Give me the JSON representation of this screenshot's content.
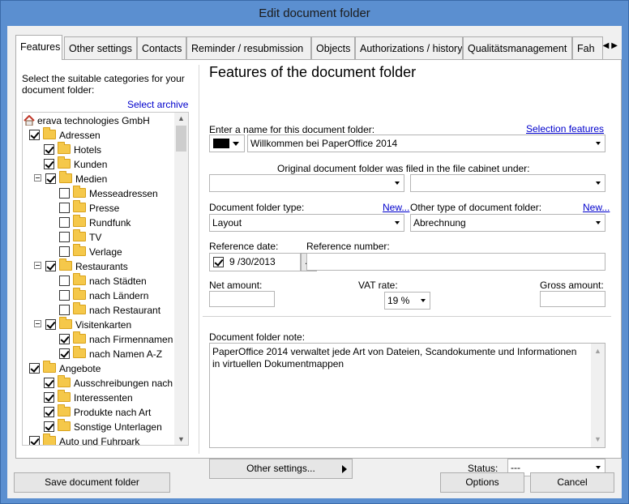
{
  "window": {
    "title": "Edit document folder"
  },
  "tabs": [
    {
      "label": "Features",
      "active": true
    },
    {
      "label": "Other settings"
    },
    {
      "label": "Contacts"
    },
    {
      "label": "Reminder / resubmission"
    },
    {
      "label": "Objects"
    },
    {
      "label": "Authorizations / history"
    },
    {
      "label": "Qualitätsmanagement"
    },
    {
      "label": "Fah"
    }
  ],
  "tab_scroll": {
    "left": "◀",
    "right": "▶"
  },
  "left": {
    "instruction": "Select the suitable categories for your document folder:",
    "select_archive": "Select archive",
    "tree": [
      {
        "label": "erava technologies GmbH",
        "level": 0,
        "type": "root"
      },
      {
        "label": "Adressen",
        "level": 0,
        "checked": true
      },
      {
        "label": "Hotels",
        "level": 1,
        "checked": true
      },
      {
        "label": "Kunden",
        "level": 1,
        "checked": true
      },
      {
        "label": "Medien",
        "level": 1,
        "checked": true,
        "expander": true
      },
      {
        "label": "Messeadressen",
        "level": 2,
        "checked": false
      },
      {
        "label": "Presse",
        "level": 2,
        "checked": false
      },
      {
        "label": "Rundfunk",
        "level": 2,
        "checked": false
      },
      {
        "label": "TV",
        "level": 2,
        "checked": false
      },
      {
        "label": "Verlage",
        "level": 2,
        "checked": false
      },
      {
        "label": "Restaurants",
        "level": 1,
        "checked": true,
        "expander": true
      },
      {
        "label": "nach Städten",
        "level": 2,
        "checked": false
      },
      {
        "label": "nach Ländern",
        "level": 2,
        "checked": false
      },
      {
        "label": "nach Restaurant",
        "level": 2,
        "checked": false
      },
      {
        "label": "Visitenkarten",
        "level": 1,
        "checked": true,
        "expander": true
      },
      {
        "label": "nach Firmennamen A-Z",
        "level": 2,
        "checked": true
      },
      {
        "label": "nach Namen A-Z",
        "level": 2,
        "checked": true
      },
      {
        "label": "Angebote",
        "level": 0,
        "checked": true
      },
      {
        "label": "Ausschreibungen nach Datum",
        "level": 1,
        "checked": true
      },
      {
        "label": "Interessenten",
        "level": 1,
        "checked": true
      },
      {
        "label": "Produkte nach Art",
        "level": 1,
        "checked": true
      },
      {
        "label": "Sonstige Unterlagen",
        "level": 1,
        "checked": true
      },
      {
        "label": "Auto und Fuhrpark",
        "level": 0,
        "checked": true
      }
    ]
  },
  "main": {
    "heading": "Features of the document folder",
    "name_label": "Enter a name for this document folder:",
    "selection_features": "Selection features",
    "color_value": "#000000",
    "name_value": "Willkommen bei PaperOffice 2014",
    "original_label": "Original document folder was filed in the file cabinet under:",
    "original_left": "",
    "original_right": "",
    "type_label": "Document folder type:",
    "type_new": "New...",
    "type_value": "Layout",
    "other_type_label": "Other type of document folder:",
    "other_type_new": "New...",
    "other_type_value": "Abrechnung",
    "ref_date_label": "Reference date:",
    "ref_date_value": "9 /30/2013",
    "ref_date_checked": true,
    "ref_date_button": "...",
    "ref_number_label": "Reference number:",
    "ref_number_value": "",
    "net_label": "Net amount:",
    "net_value": "",
    "vat_label": "VAT rate:",
    "vat_value": "19 %",
    "gross_label": "Gross amount:",
    "gross_value": "",
    "note_label": "Document folder note:",
    "note_value": "PaperOffice 2014 verwaltet jede Art von Dateien, Scandokumente und Informationen in virtuellen Dokumentmappen",
    "other_settings_button": "Other settings...",
    "status_label": "Status:",
    "status_value": "---"
  },
  "footer": {
    "save": "Save document folder",
    "options": "Options",
    "cancel": "Cancel"
  }
}
